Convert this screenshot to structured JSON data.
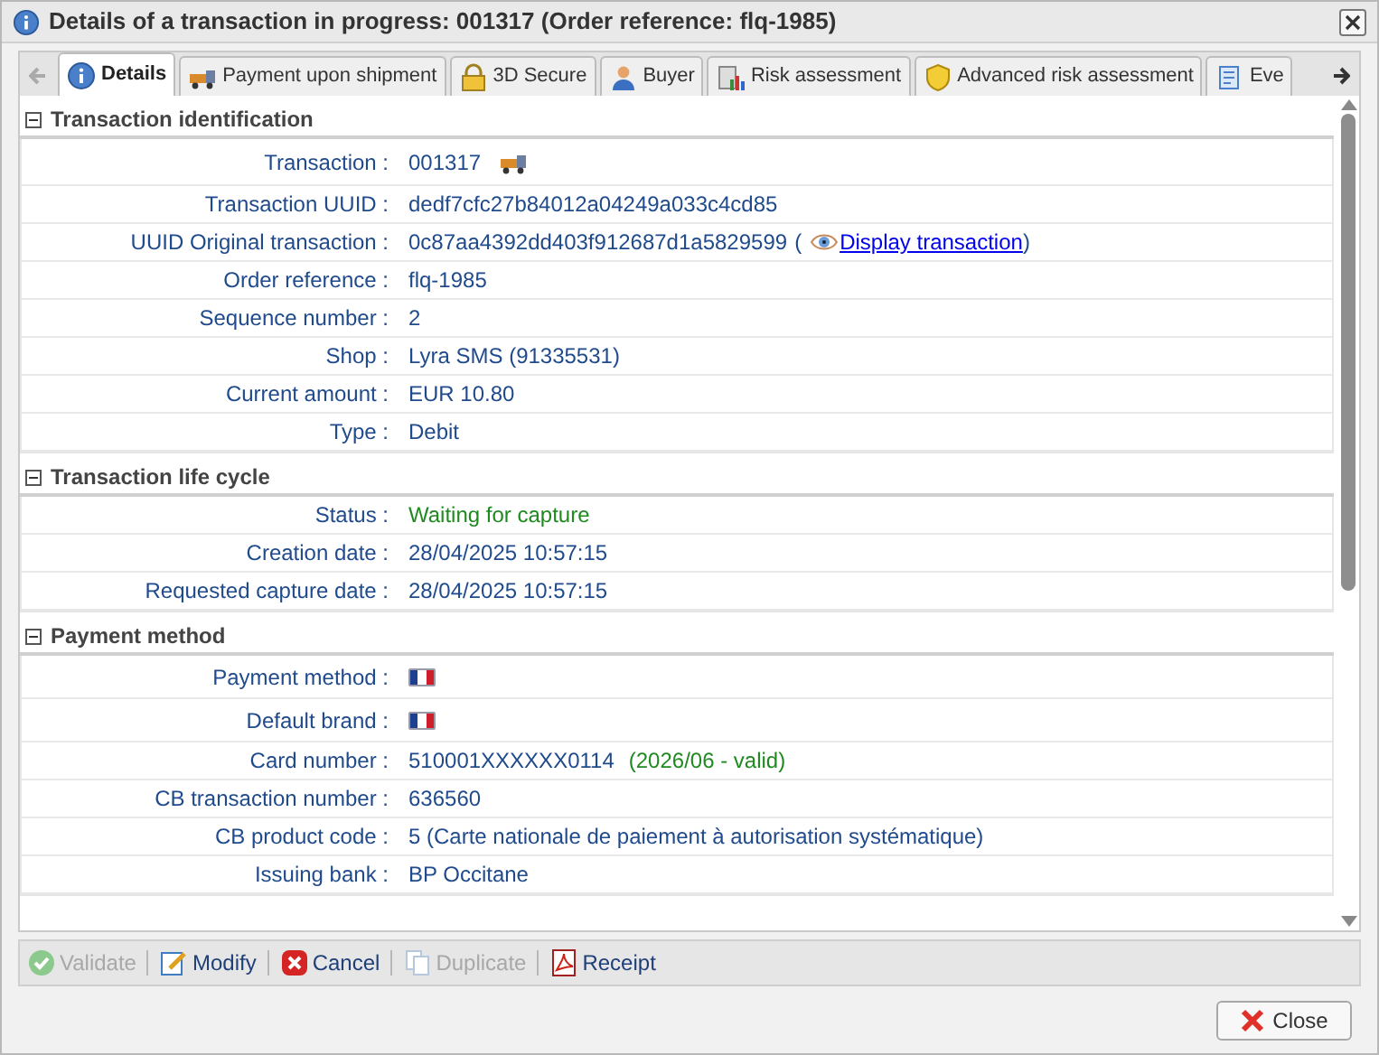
{
  "window": {
    "title": "Details of a transaction in progress: 001317 (Order reference: flq-1985)"
  },
  "tabs": [
    {
      "label": "Details",
      "kind": "info",
      "selected": true
    },
    {
      "label": "Payment upon shipment",
      "kind": "truck",
      "selected": false
    },
    {
      "label": "3D Secure",
      "kind": "lock",
      "selected": false
    },
    {
      "label": "Buyer",
      "kind": "person",
      "selected": false
    },
    {
      "label": "Risk assessment",
      "kind": "chart",
      "selected": false
    },
    {
      "label": "Advanced risk assessment",
      "kind": "shield",
      "selected": false
    },
    {
      "label": "Eve",
      "kind": "scroll",
      "selected": false
    }
  ],
  "sections": [
    {
      "title": "Transaction identification",
      "expanded": true,
      "rows": [
        {
          "kind": "truck",
          "label": "Transaction :",
          "value": "001317"
        },
        {
          "kind": "text",
          "label": "Transaction UUID :",
          "value": "dedf7cfc27b84012a04249a033c4cd85"
        },
        {
          "kind": "link",
          "label": "UUID Original transaction :",
          "value": "0c87aa4392dd403f912687d1a5829599",
          "open": "(",
          "link": "Display transaction",
          "close": ")"
        },
        {
          "kind": "text",
          "label": "Order reference :",
          "value": "flq-1985"
        },
        {
          "kind": "text",
          "label": "Sequence number :",
          "value": "2"
        },
        {
          "kind": "text",
          "label": "Shop :",
          "value": "Lyra SMS (91335531)"
        },
        {
          "kind": "text",
          "label": "Current amount :",
          "value": "EUR 10.80"
        },
        {
          "kind": "text",
          "label": "Type :",
          "value": "Debit"
        }
      ]
    },
    {
      "title": "Transaction life cycle",
      "expanded": true,
      "rows": [
        {
          "kind": "success",
          "label": "Status :",
          "value": "Waiting for capture"
        },
        {
          "kind": "text",
          "label": "Creation date :",
          "value": "28/04/2025 10:57:15"
        },
        {
          "kind": "text",
          "label": "Requested capture date :",
          "value": "28/04/2025 10:57:15"
        }
      ]
    },
    {
      "title": "Payment method",
      "expanded": true,
      "rows": [
        {
          "kind": "brand",
          "label": "Payment method :"
        },
        {
          "kind": "brand",
          "label": "Default brand :"
        },
        {
          "kind": "card",
          "label": "Card number :",
          "value": "510001XXXXXX0114",
          "note": "(2026/06 - valid)"
        },
        {
          "kind": "text",
          "label": "CB transaction number :",
          "value": "636560"
        },
        {
          "kind": "text",
          "label": "CB product code :",
          "value": "5 (Carte nationale de paiement à autorisation systématique)"
        },
        {
          "kind": "text",
          "label": "Issuing bank :",
          "value": "BP Occitane"
        }
      ]
    }
  ],
  "toolbar": [
    {
      "label": "Validate",
      "kind": "check",
      "disabled": true
    },
    {
      "label": "Modify",
      "kind": "edit",
      "disabled": false
    },
    {
      "label": "Cancel",
      "kind": "cancel",
      "disabled": false
    },
    {
      "label": "Duplicate",
      "kind": "copy",
      "disabled": true
    },
    {
      "label": "Receipt",
      "kind": "pdf",
      "disabled": false
    }
  ],
  "close_button": {
    "label": "Close"
  }
}
